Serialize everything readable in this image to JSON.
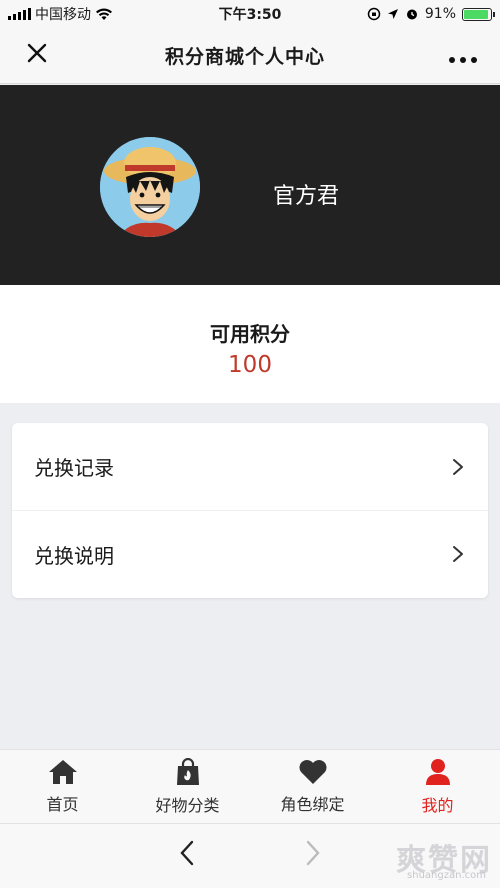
{
  "status_bar": {
    "carrier": "中国移动",
    "time": "下午3:50",
    "battery_percent": "91%",
    "battery_level": 0.91
  },
  "nav": {
    "title": "积分商城个人中心",
    "close_icon": "close-icon",
    "more_icon": "more-icon"
  },
  "profile": {
    "username": "官方君"
  },
  "points": {
    "label": "可用积分",
    "value": "100"
  },
  "menu": {
    "items": [
      {
        "label": "兑换记录"
      },
      {
        "label": "兑换说明"
      }
    ]
  },
  "tabs": [
    {
      "label": "首页",
      "icon": "home-icon"
    },
    {
      "label": "好物分类",
      "icon": "bag-icon"
    },
    {
      "label": "角色绑定",
      "icon": "heart-icon"
    },
    {
      "label": "我的",
      "icon": "user-icon",
      "active": true
    }
  ],
  "colors": {
    "accent": "#e0231f",
    "header_bg": "#222222",
    "points_value": "#c0392b"
  },
  "watermark": {
    "text": "爽赞网",
    "sub": "shuangzan.com"
  }
}
